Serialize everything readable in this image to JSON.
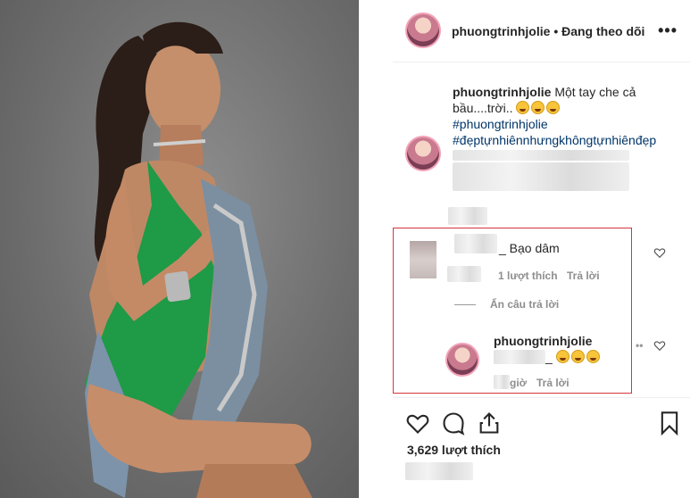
{
  "post": {
    "username": "phuongtrinhjolie",
    "separator": "•",
    "follow_status": "Đang theo dõi",
    "more_label": "•••"
  },
  "caption": {
    "username": "phuongtrinhjolie",
    "text": "Một tay che cả bầu....trời..",
    "emoji_count": 3,
    "hashtags": [
      "#phuongtrinhjolie",
      "#đẹptựnhiênnhưngkhôngtựnhiênđẹp"
    ]
  },
  "comment": {
    "text": "_ Bạo dâm",
    "likes_label": "1 lượt thích",
    "reply_label": "Trả lời",
    "hide_replies_label": "Ẩn câu trả lời"
  },
  "reply": {
    "username": "phuongtrinhjolie",
    "mention_suffix": "_",
    "time_label": "giờ",
    "reply_label": "Trả lời"
  },
  "actions": {
    "likes_text": "3,629 lượt thích"
  },
  "colors": {
    "highlight_border": "#d4363a",
    "hashtag": "#003569",
    "muted": "#8e8e8e"
  },
  "icons": [
    "heart-icon",
    "comment-icon",
    "share-icon",
    "bookmark-icon",
    "more-icon"
  ]
}
